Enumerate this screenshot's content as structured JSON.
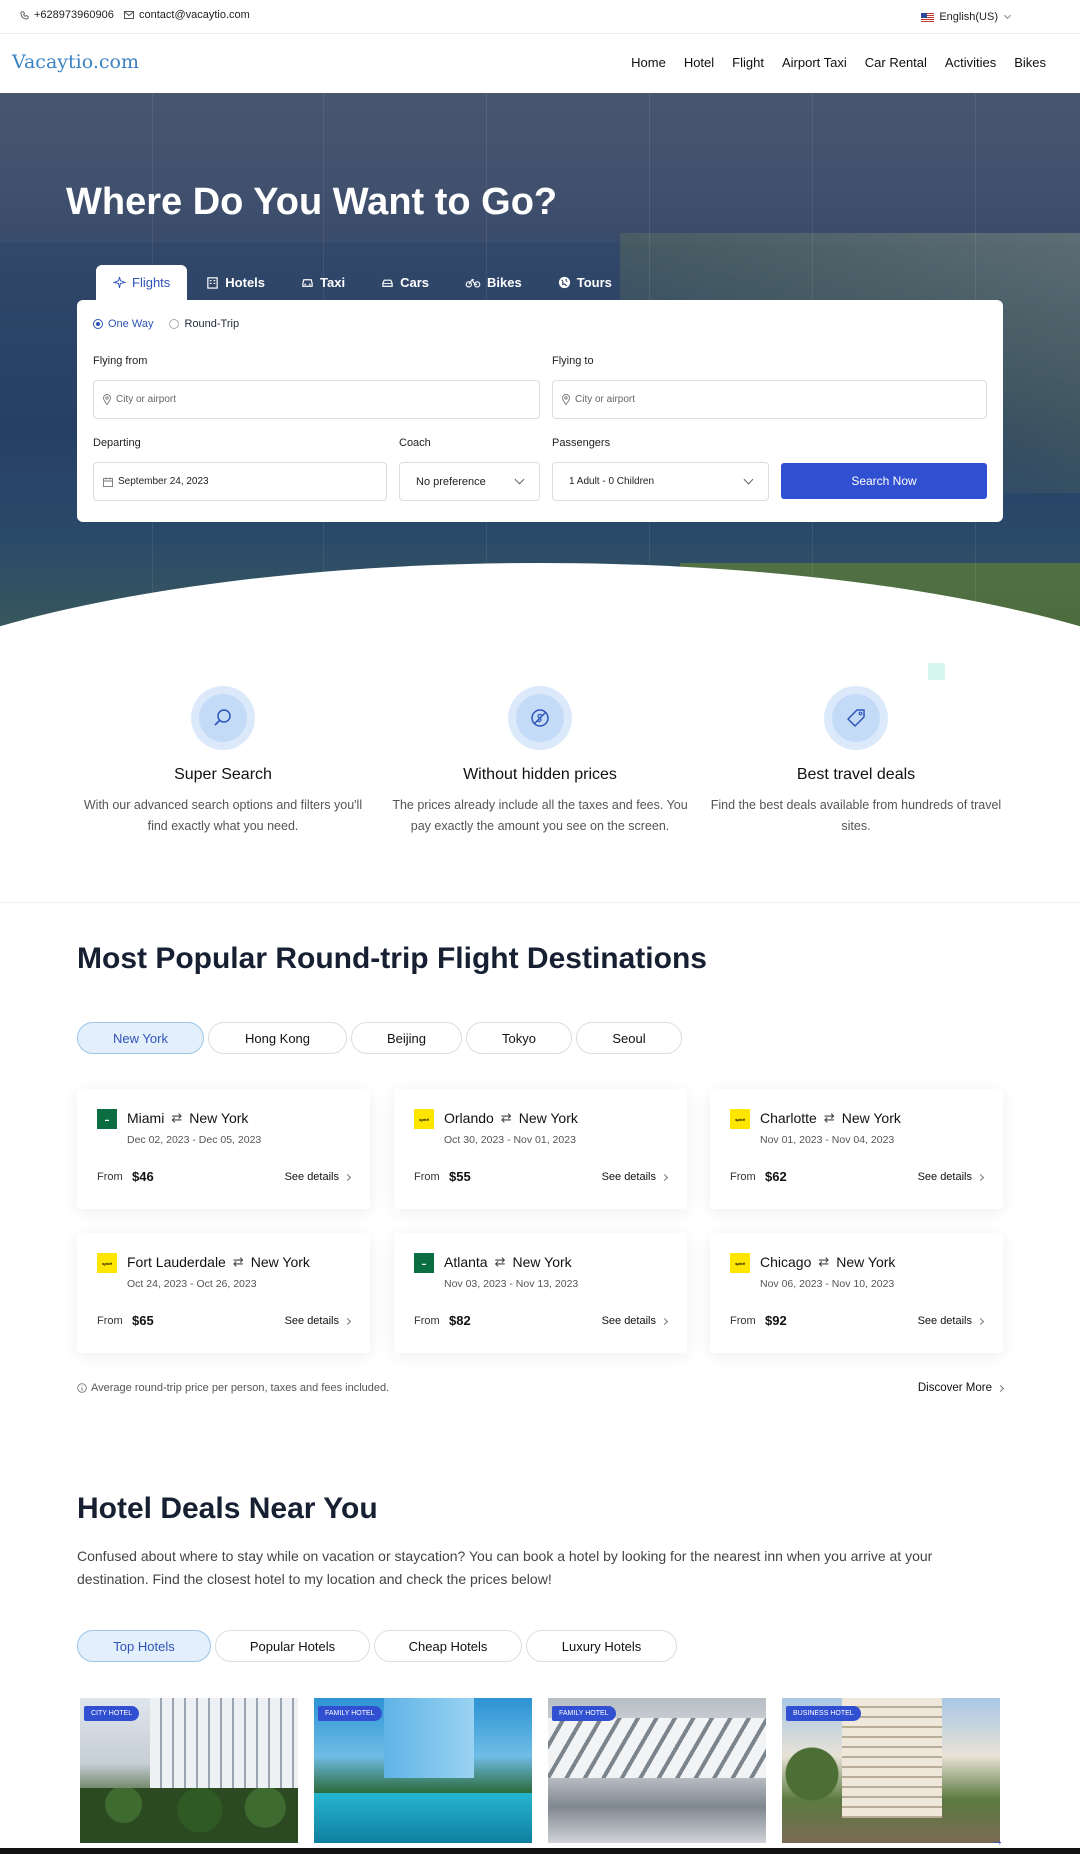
{
  "topbar": {
    "phone": "+628973960906",
    "email": "contact@vacaytio.com",
    "language": "English(US)"
  },
  "header": {
    "logo": "Vacaytio.com",
    "nav": [
      "Home",
      "Hotel",
      "Flight",
      "Airport Taxi",
      "Car Rental",
      "Activities",
      "Bikes"
    ]
  },
  "hero": {
    "title": "Where Do You Want to Go?",
    "tabs": [
      {
        "label": "Flights",
        "icon": "plane-icon"
      },
      {
        "label": "Hotels",
        "icon": "building-icon"
      },
      {
        "label": "Taxi",
        "icon": "taxi-icon"
      },
      {
        "label": "Cars",
        "icon": "car-icon"
      },
      {
        "label": "Bikes",
        "icon": "bike-icon"
      },
      {
        "label": "Tours",
        "icon": "globe-icon"
      }
    ],
    "active_tab": "Flights"
  },
  "search": {
    "trip_types": [
      "One Way",
      "Round-Trip"
    ],
    "selected_trip": "One Way",
    "flying_from_label": "Flying from",
    "flying_from_placeholder": "City or airport",
    "flying_to_label": "Flying to",
    "flying_to_placeholder": "City or airport",
    "departing_label": "Departing",
    "departing_value": "September 24, 2023",
    "coach_label": "Coach",
    "coach_value": "No preference",
    "passengers_label": "Passengers",
    "passengers_value": "1 Adult - 0 Children",
    "submit_label": "Search Now"
  },
  "features": [
    {
      "title": "Super Search",
      "text": "With our advanced search options and filters you'll find exactly what you need."
    },
    {
      "title": "Without hidden prices",
      "text": "The prices already include all the taxes and fees. You pay exactly the amount you see on the screen."
    },
    {
      "title": "Best travel deals",
      "text": "Find the best deals available from hundreds of travel sites."
    }
  ],
  "destinations": {
    "title": "Most Popular Round-trip Flight Destinations",
    "cities": [
      "New York",
      "Hong Kong",
      "Beijing",
      "Tokyo",
      "Seoul"
    ],
    "active_city": "New York",
    "from_label": "From",
    "details_label": "See details",
    "cards": [
      {
        "origin": "Miami",
        "destination": "New York",
        "dates": "Dec 02, 2023 - Dec 05, 2023",
        "price": "$46",
        "airline": "green"
      },
      {
        "origin": "Orlando",
        "destination": "New York",
        "dates": "Oct 30, 2023 - Nov 01, 2023",
        "price": "$55",
        "airline": "spirit"
      },
      {
        "origin": "Charlotte",
        "destination": "New York",
        "dates": "Nov 01, 2023 - Nov 04, 2023",
        "price": "$62",
        "airline": "spirit"
      },
      {
        "origin": "Fort Lauderdale",
        "destination": "New York",
        "dates": "Oct 24, 2023 - Oct 26, 2023",
        "price": "$65",
        "airline": "spirit"
      },
      {
        "origin": "Atlanta",
        "destination": "New York",
        "dates": "Nov 03, 2023 - Nov 13, 2023",
        "price": "$82",
        "airline": "green"
      },
      {
        "origin": "Chicago",
        "destination": "New York",
        "dates": "Nov 06, 2023 - Nov 10, 2023",
        "price": "$92",
        "airline": "spirit"
      }
    ],
    "note": "Average round-trip price per person, taxes and fees included.",
    "discover_label": "Discover More"
  },
  "hotels": {
    "title": "Hotel Deals Near You",
    "lead": "Confused about where to stay while on vacation or staycation? You can book a hotel by looking for the nearest inn when you arrive at your destination. Find the closest hotel to my location and check the prices below!",
    "tabs": [
      "Top Hotels",
      "Popular Hotels",
      "Cheap Hotels",
      "Luxury Hotels"
    ],
    "active_tab": "Top Hotels",
    "cards": [
      {
        "tag": "CITY HOTEL"
      },
      {
        "tag": "FAMILY HOTEL"
      },
      {
        "tag": "FAMILY HOTEL"
      },
      {
        "tag": "BUSINESS HOTEL"
      }
    ]
  },
  "colors": {
    "primary": "#3150d1",
    "logo": "#3b82c4",
    "heading": "#172033",
    "hero_overlay": "#2c4467",
    "pill_active_bg": "#e3effa"
  }
}
